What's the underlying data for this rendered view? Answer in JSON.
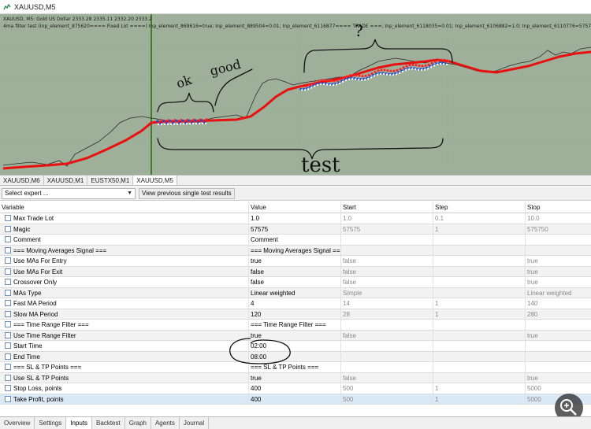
{
  "window": {
    "title": "XAUUSD,M5"
  },
  "chart": {
    "info_line1": "XAUUSD, M5:  Gold US Dollar  2333.28 2335.11 2332.20 2333.2",
    "info_line2": "4ma filter test (Inp_element_875620==== Fixed Lot ====) Inp_element_869616=true; Inp_element_889504=0.01; Inp_element_6116877==== TRADE ===; Inp_element_6118035=0.01; Inp_element_6106882=1.0; Inp_element_6110776=57575; Inp_element_61",
    "background": "#9fb09a",
    "price_color": "#2b2b2b",
    "ma_color": "#e81010"
  },
  "annotations": {
    "ok": "ok",
    "good": "good",
    "test": "test",
    "question": "?"
  },
  "chart_tabs": [
    {
      "label": "XAUUSD,M6"
    },
    {
      "label": "XAUUSD,M1"
    },
    {
      "label": "EUSTX50,M1"
    },
    {
      "label": "XAUUSD,M5"
    }
  ],
  "expert": {
    "select_value": "Select expert ...",
    "results_button": "View previous single test results"
  },
  "table": {
    "columns": [
      "Variable",
      "Value",
      "Start",
      "Step",
      "Stop"
    ],
    "rows": [
      {
        "variable": "Max Trade Lot",
        "value": "1.0",
        "start": "1.0",
        "step": "0.1",
        "stop": "10.0",
        "checked": false
      },
      {
        "variable": "Magic",
        "value": "57575",
        "start": "57575",
        "step": "1",
        "stop": "575750",
        "checked": false
      },
      {
        "variable": "Comment",
        "value": "Comment",
        "start": "",
        "step": "",
        "stop": "",
        "checked": false
      },
      {
        "variable": "=== Moving Averages Signal ===",
        "value": "=== Moving Averages Signal ===",
        "start": "",
        "step": "",
        "stop": "",
        "checked": false
      },
      {
        "variable": "Use MAs For Entry",
        "value": "true",
        "start": "false",
        "step": "",
        "stop": "true",
        "checked": false
      },
      {
        "variable": "Use MAs For Exit",
        "value": "false",
        "start": "false",
        "step": "",
        "stop": "true",
        "checked": false
      },
      {
        "variable": "Crossover Only",
        "value": "false",
        "start": "false",
        "step": "",
        "stop": "true",
        "checked": false
      },
      {
        "variable": "MAs Type",
        "value": "Linear weighted",
        "start": "Simple",
        "step": "",
        "stop": "Linear weighted",
        "checked": false
      },
      {
        "variable": "Fast MA Period",
        "value": "4",
        "start": "14",
        "step": "1",
        "stop": "140",
        "checked": false
      },
      {
        "variable": "Slow MA Period",
        "value": "120",
        "start": "28",
        "step": "1",
        "stop": "280",
        "checked": false
      },
      {
        "variable": "=== Time Range Filter ===",
        "value": "=== Time Range Filter ===",
        "start": "",
        "step": "",
        "stop": "",
        "checked": false
      },
      {
        "variable": "Use Time Range Filter",
        "value": "true",
        "start": "false",
        "step": "",
        "stop": "true",
        "checked": false
      },
      {
        "variable": "Start Time",
        "value": "02:00",
        "start": "",
        "step": "",
        "stop": "",
        "checked": false
      },
      {
        "variable": "End Time",
        "value": "08:00",
        "start": "",
        "step": "",
        "stop": "",
        "checked": false
      },
      {
        "variable": "=== SL & TP Points ===",
        "value": "=== SL & TP Points ===",
        "start": "",
        "step": "",
        "stop": "",
        "checked": false
      },
      {
        "variable": "Use SL & TP Points",
        "value": "true",
        "start": "false",
        "step": "",
        "stop": "true",
        "checked": false
      },
      {
        "variable": "Stop Loss, points",
        "value": "400",
        "start": "500",
        "step": "1",
        "stop": "5000",
        "checked": false
      },
      {
        "variable": "Take Profit, points",
        "value": "400",
        "start": "500",
        "step": "1",
        "stop": "5000",
        "checked": false
      }
    ]
  },
  "bottom_tabs": [
    {
      "label": "Overview"
    },
    {
      "label": "Settings"
    },
    {
      "label": "Inputs"
    },
    {
      "label": "Backtest"
    },
    {
      "label": "Graph"
    },
    {
      "label": "Agents"
    },
    {
      "label": "Journal"
    }
  ]
}
